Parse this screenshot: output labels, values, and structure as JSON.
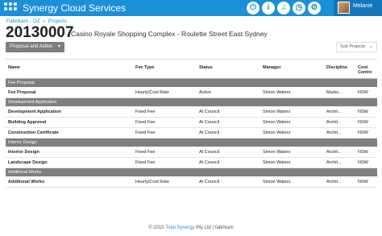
{
  "header": {
    "app_title": "Synergy Cloud Services",
    "user_name": "Melanie",
    "icons": [
      "power-icon",
      "info-icon",
      "bell-icon",
      "pin-icon",
      "clock-icon",
      "settings-icon"
    ]
  },
  "breadcrumb": [
    "Fabrikam - OZ",
    "Projects"
  ],
  "project": {
    "code": "20130007",
    "name": "Casino Royale Shopping Complex - Roulette Street East Sydney"
  },
  "status_button": "Proposal and Active",
  "sub_projects_label": "Sub Projects",
  "table": {
    "columns": [
      "Name",
      "Fee Type",
      "Status",
      "Manager",
      "Discipline",
      "Cost Centre"
    ],
    "groups": [
      {
        "label": "Fee Proposal",
        "rows": [
          [
            "Fee Proposal",
            "Hourly/Cost Rate",
            "Active",
            "Simon Waters",
            "Marke...",
            "NSW"
          ]
        ]
      },
      {
        "label": "Development Application",
        "rows": [
          [
            "Development Application",
            "Fixed Fee",
            "At Council",
            "Simon Waters",
            "Archit...",
            "NSW"
          ],
          [
            "Building Approval",
            "Fixed Fee",
            "At Council",
            "Simon Waters",
            "Archit...",
            "NSW"
          ],
          [
            "Construction Certificate",
            "Fixed Fee",
            "At Council",
            "Simon Waters",
            "Archit...",
            "NSW"
          ]
        ]
      },
      {
        "label": "Interior Design",
        "rows": [
          [
            "Interior Design",
            "Fixed Fee",
            "At Council",
            "Simon Waters",
            "Archit...",
            "NSW"
          ],
          [
            "Landscape Design",
            "Fixed Fee",
            "At Council",
            "Simon Waters",
            "Archit...",
            "NSW"
          ]
        ]
      },
      {
        "label": "Additional Works",
        "rows": [
          [
            "Additional Works",
            "Hourly/Cost Rate",
            "At Council",
            "Simon Waters",
            "Archit...",
            "NSW"
          ]
        ]
      }
    ]
  },
  "footer": {
    "prefix": "© 2015 ",
    "company": "Total Synergy",
    "suffix": " Pty Ltd | fabrikam"
  }
}
